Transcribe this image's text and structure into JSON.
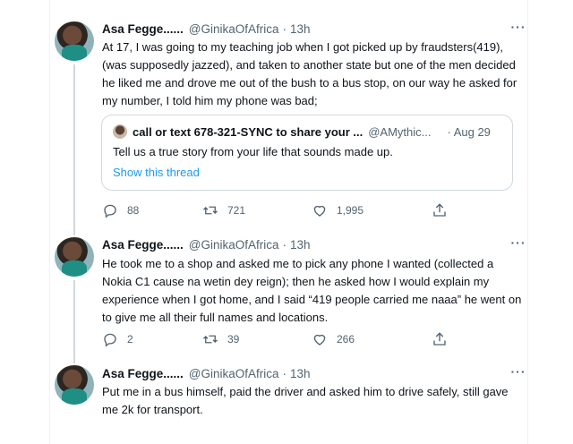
{
  "tweets": [
    {
      "name": "Asa Fegge......",
      "handle": "@GinikaOfAfrica",
      "time": "13h",
      "text": "At 17, I was going to my teaching job when I got picked up by fraudsters(419), (was supposedly jazzed), and taken to another state but one of the men decided he liked me and drove me out of the bush to a bus stop, on our way he asked for my number, I told him my phone was bad;",
      "quote": {
        "name": "call or text 678-321-SYNC to share your ...",
        "handle": "@AMythic...",
        "date": "· Aug 29",
        "text": "Tell us a true story from your life that sounds made up.",
        "link": "Show this thread"
      },
      "replies": "88",
      "retweets": "721",
      "likes": "1,995"
    },
    {
      "name": "Asa Fegge......",
      "handle": "@GinikaOfAfrica",
      "time": "13h",
      "text": "He took me to a shop and asked me to pick any phone I wanted (collected a Nokia C1 cause na wetin dey reign); then he asked how I would explain my experience when I got home, and I said “419 people carried me naaa”  he went on to give me all their full names and locations.",
      "replies": "2",
      "retweets": "39",
      "likes": "266"
    },
    {
      "name": "Asa Fegge......",
      "handle": "@GinikaOfAfrica",
      "time": "13h",
      "text": "Put me in a bus himself, paid the driver and asked him to drive safely, still gave me 2k for transport."
    }
  ],
  "icons": {
    "more": "more-icon",
    "reply": "reply-icon",
    "retweet": "retweet-icon",
    "like": "heart-icon",
    "share": "share-icon"
  }
}
